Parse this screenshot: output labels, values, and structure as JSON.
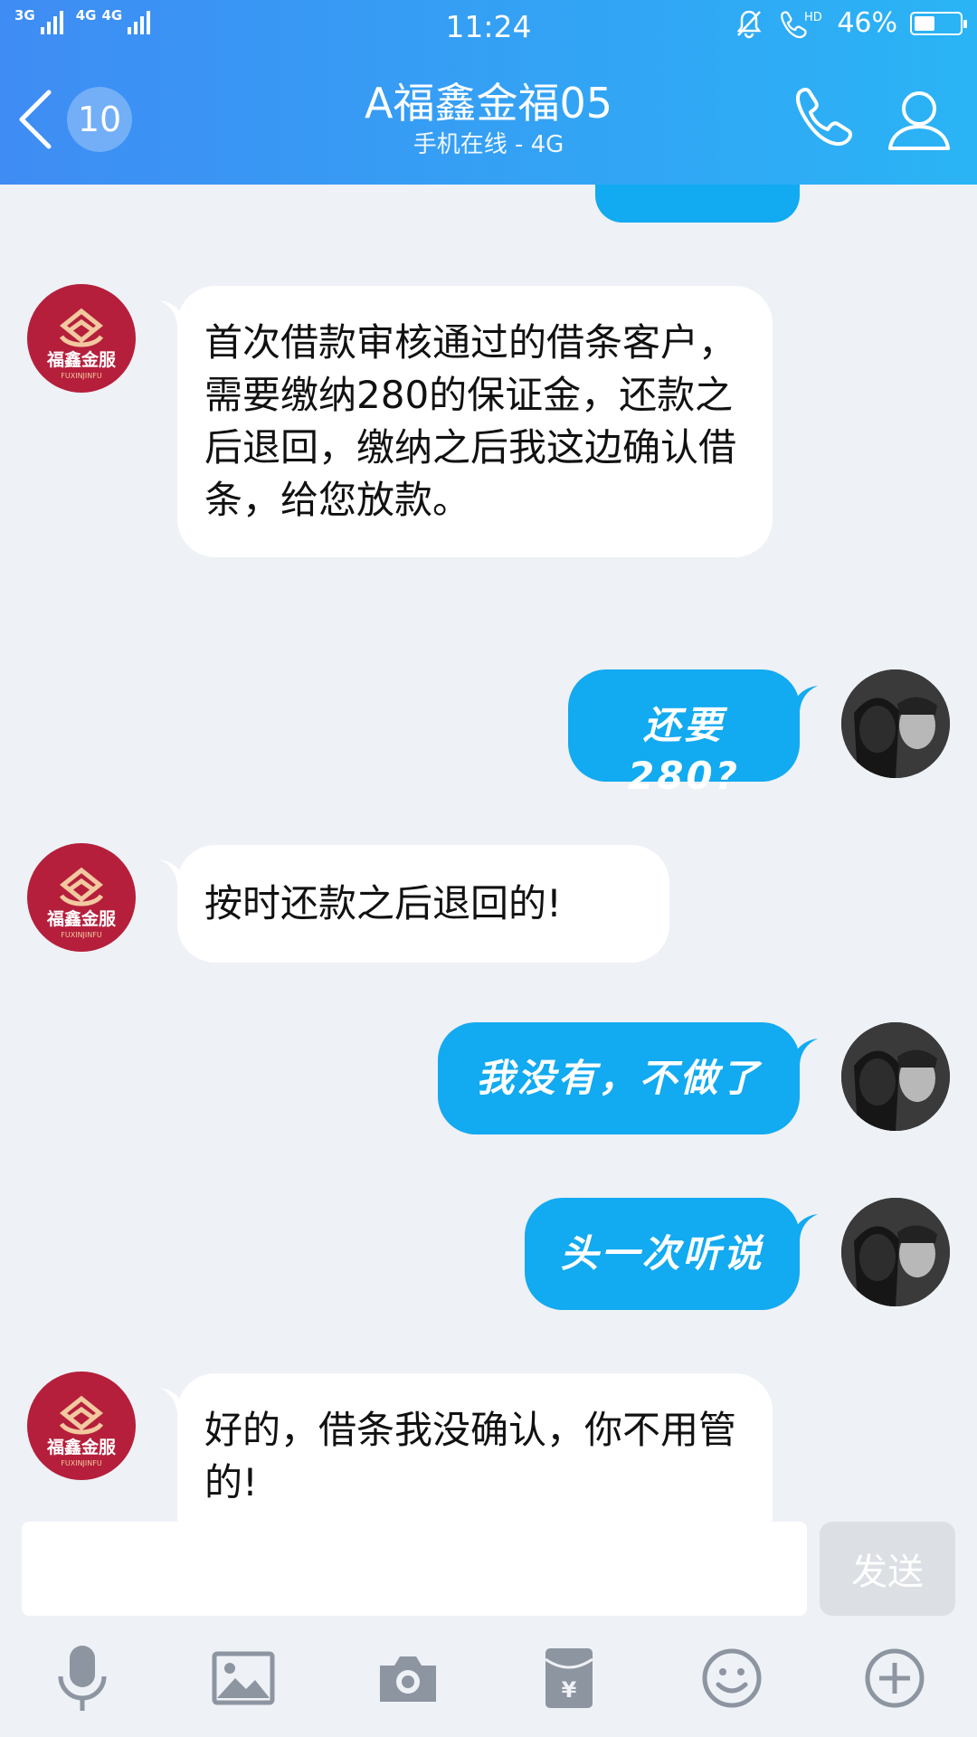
{
  "status_bar": {
    "net1": "3G",
    "net2": "4G",
    "net3": "4G",
    "time": "11:24",
    "hd": "HD",
    "battery_percent": "46%",
    "battery_level": 0.46
  },
  "header": {
    "unread_count": "10",
    "title": "A福鑫金福05",
    "subtitle": "手机在线 - 4G"
  },
  "brand_avatar": {
    "name": "福鑫金服",
    "pinyin": "FUXINJINFU"
  },
  "messages": [
    {
      "from": "contact",
      "text": "首次借款审核通过的借条客户，需要缴纳280的保证金，还款之后退回，缴纳之后我这边确认借条，给您放款。"
    },
    {
      "from": "me",
      "text": "还要280?"
    },
    {
      "from": "contact",
      "text": "按时还款之后退回的!"
    },
    {
      "from": "me",
      "text": "我没有，不做了"
    },
    {
      "from": "me",
      "text": "头一次听说"
    },
    {
      "from": "contact",
      "text": "好的，借条我没确认，你不用管的!"
    }
  ],
  "composer": {
    "placeholder": "",
    "send_label": "发送"
  },
  "toolbar": {
    "icons": [
      "microphone-icon",
      "image-icon",
      "camera-icon",
      "red-packet-icon",
      "emoji-icon",
      "plus-icon"
    ],
    "red_packet_symbol": "¥"
  },
  "colors": {
    "header_start": "#3f8cf4",
    "header_end": "#2ab4f5",
    "bubble_out": "#12aaf0",
    "bubble_in": "#ffffff",
    "background": "#eef1f6",
    "brand": "#b51f3b"
  }
}
